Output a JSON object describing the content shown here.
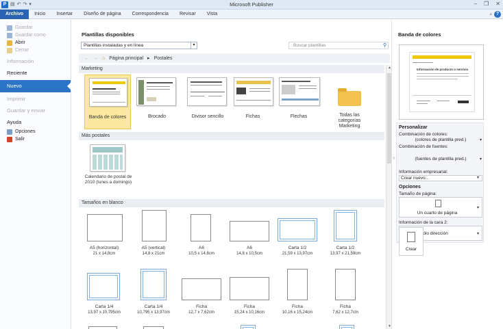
{
  "window": {
    "title": "Microsoft Publisher",
    "qat_icons": [
      "publisher-logo-icon",
      "save-icon",
      "undo-icon",
      "redo-icon",
      "customize-icon"
    ]
  },
  "ribbon": {
    "tabs": [
      "Archivo",
      "Inicio",
      "Insertar",
      "Diseño de página",
      "Correspondencia",
      "Revisar",
      "Vista"
    ]
  },
  "nav": {
    "top_items": [
      {
        "label": "Guardar",
        "icon": "save-icon",
        "enabled": false
      },
      {
        "label": "Guardar como",
        "icon": "save-as-icon",
        "enabled": false
      },
      {
        "label": "Abrir",
        "icon": "open-folder-icon",
        "enabled": true
      },
      {
        "label": "Cerrar",
        "icon": "close-icon",
        "enabled": false
      }
    ],
    "informacion": "Información",
    "reciente": "Reciente",
    "nuevo": "Nuevo",
    "imprimir": "Imprimir",
    "guardar_enviar": "Guardar y enviar",
    "ayuda": "Ayuda",
    "opciones": "Opciones",
    "salir": "Salir"
  },
  "templates": {
    "heading": "Plantillas disponibles",
    "source_dropdown": "Plantillas instaladas y en línea",
    "search_placeholder": "Buscar plantillas",
    "breadcrumb_home": "Página principal",
    "breadcrumb_sep": "▸",
    "breadcrumb_current": "Postales",
    "sections": {
      "marketing": "Marketing",
      "mas_postales": "Más postales",
      "tamanos": "Tamaños en blanco"
    },
    "marketing_items": [
      {
        "label": "Banda de colores",
        "selected": true
      },
      {
        "label": "Brocado",
        "selected": false
      },
      {
        "label": "Divisor sencillo",
        "selected": false
      },
      {
        "label": "Fichas",
        "selected": false
      },
      {
        "label": "Flechas",
        "selected": false
      },
      {
        "label": "Todas las categorías Marketing",
        "selected": false
      }
    ],
    "mas_postales_items": [
      {
        "label": "Calendario de postal de 2010 (lunes a domingo)"
      }
    ],
    "blank_sizes": [
      {
        "name": "A5 (horizontal)",
        "size": "21 x 14,8cm"
      },
      {
        "name": "A5 (vertical)",
        "size": "14,8 x 21cm"
      },
      {
        "name": "A6",
        "size": "10,5 x 14,8cm"
      },
      {
        "name": "A6",
        "size": "14,8 x 10,5cm"
      },
      {
        "name": "Carta 1/2",
        "size": "21,59 x 13,97cm"
      },
      {
        "name": "Carta 1/2",
        "size": "13,97 x 21,59cm"
      },
      {
        "name": "Carta 1/4",
        "size": "13,97 x 10,795cm"
      },
      {
        "name": "Carta 1/4",
        "size": "10,795 x 13,97cm"
      },
      {
        "name": "Ficha",
        "size": "12,7 x 7,62cm"
      },
      {
        "name": "Ficha",
        "size": "15,24 x 10,16cm"
      },
      {
        "name": "Ficha",
        "size": "10,16 x 15,24cm"
      },
      {
        "name": "Ficha",
        "size": "7,62 x 12,7cm"
      }
    ]
  },
  "preview_pane": {
    "title": "Banda de colores",
    "preview_heading": "Información de producto o servicio",
    "personalizar": "Personalizar",
    "color_scheme_label": "Combinación de colores:",
    "color_scheme_value": "(colores de plantilla pred.)",
    "font_scheme_label": "Combinación de fuentes:",
    "font_scheme_value": "(fuentes de plantilla pred.)",
    "business_info_label": "Información empresarial:",
    "business_info_value": "Crear nuevo...",
    "opciones": "Opciones",
    "page_size_label": "Tamaño de página:",
    "page_size_value": "Un cuarto de página",
    "side2_label": "Información de la cara 2:",
    "side2_value": "Sólo dirección",
    "create_label": "Crear"
  },
  "colors": {
    "accent": "#2b74c6",
    "selected_tile": "#fde8a0",
    "preview_band": "#f2c800"
  }
}
